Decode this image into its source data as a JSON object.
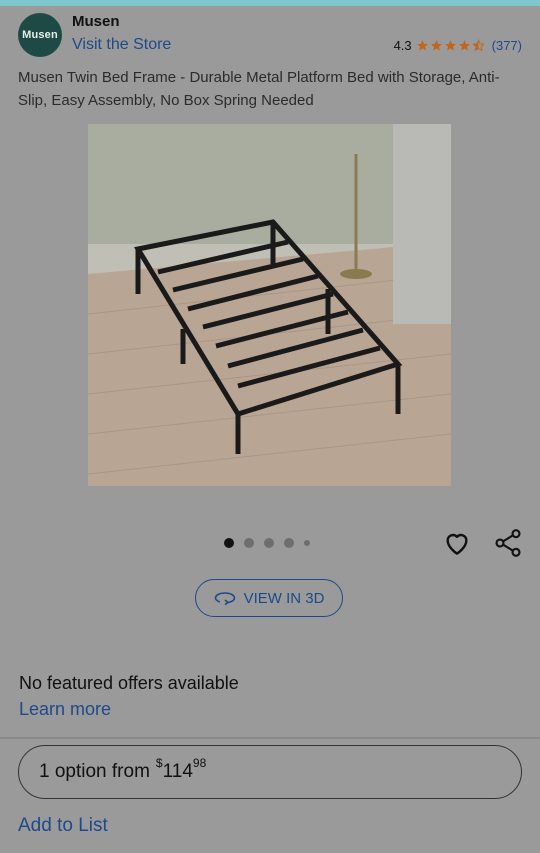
{
  "header": {
    "avatar_text": "Musen",
    "brand": "Musen",
    "store_link": "Visit the Store",
    "rating": {
      "score": "4.3",
      "stars_value": 4.3,
      "star_color": "#c1661b",
      "count": "(377)"
    }
  },
  "product": {
    "title": "Musen Twin Bed Frame - Durable Metal Platform Bed with Storage, Anti-Slip, Easy Assembly, No Box Spring Needed",
    "image_count": 5,
    "active_image_index": 0
  },
  "actions": {
    "heart_icon": "heart-icon",
    "share_icon": "share-icon",
    "view3d_label": "VIEW IN 3D"
  },
  "offers": {
    "no_offers_text": "No featured offers available",
    "learn_more": "Learn more",
    "option_text": "1 option from",
    "price_symbol": "$",
    "price_whole": "114",
    "price_cents": "98"
  },
  "footer": {
    "add_to_list": "Add to List"
  },
  "colors": {
    "link": "#1d4a8a",
    "overlay_bg": "#9a9a9a",
    "avatar_bg": "#1e4a45",
    "accent_strip": "#7fc7cf"
  }
}
